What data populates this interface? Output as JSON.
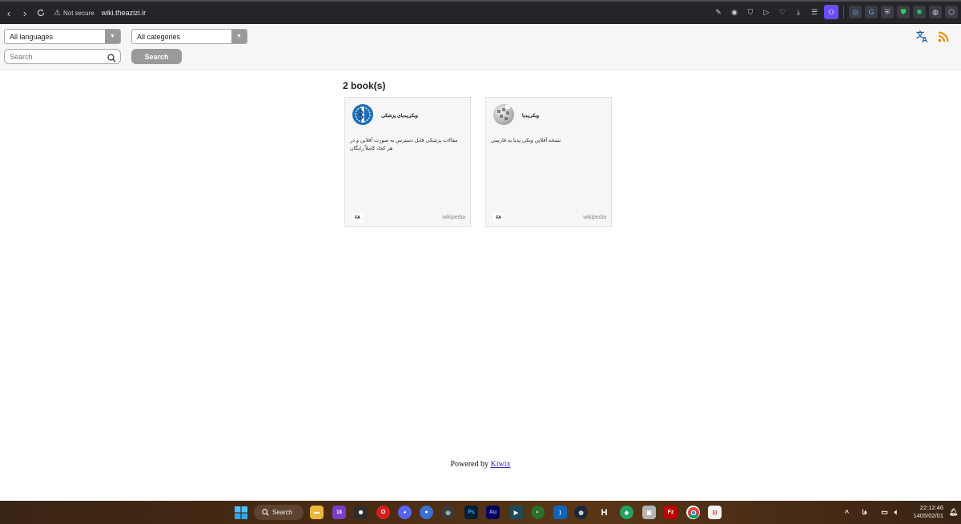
{
  "browser": {
    "security_label": "Not secure",
    "url": "wiki.theazizi.ir"
  },
  "filters": {
    "language_value": "All languages",
    "category_value": "All categories",
    "search_placeholder": "Search",
    "search_button": "Search"
  },
  "library": {
    "count_label": "2 book(s)",
    "books": [
      {
        "title": "ویکی‌پدیای پزشکی",
        "description": "مقالات پزشکی قابل دسترس به صورت آفلاین و در هر کجا، کاملاً رایگان",
        "language": "FA",
        "tag": "wikipedia"
      },
      {
        "title": "ویکی‌پدیا",
        "description": "نسخه آفلاین ویکی پدیا به فارسی",
        "language": "FA",
        "tag": "wikipedia"
      }
    ]
  },
  "footer": {
    "prefix": "Powered by",
    "link": "Kiwix"
  },
  "taskbar": {
    "search_label": "Search",
    "badge_count": "18",
    "tray_lang": "فا",
    "time": "22:12:46",
    "date": "1405/02/01"
  },
  "colors": {
    "accent_button": "#9a9a9a",
    "header_bg": "#f6f6f6",
    "link": "#3b2ab3"
  }
}
